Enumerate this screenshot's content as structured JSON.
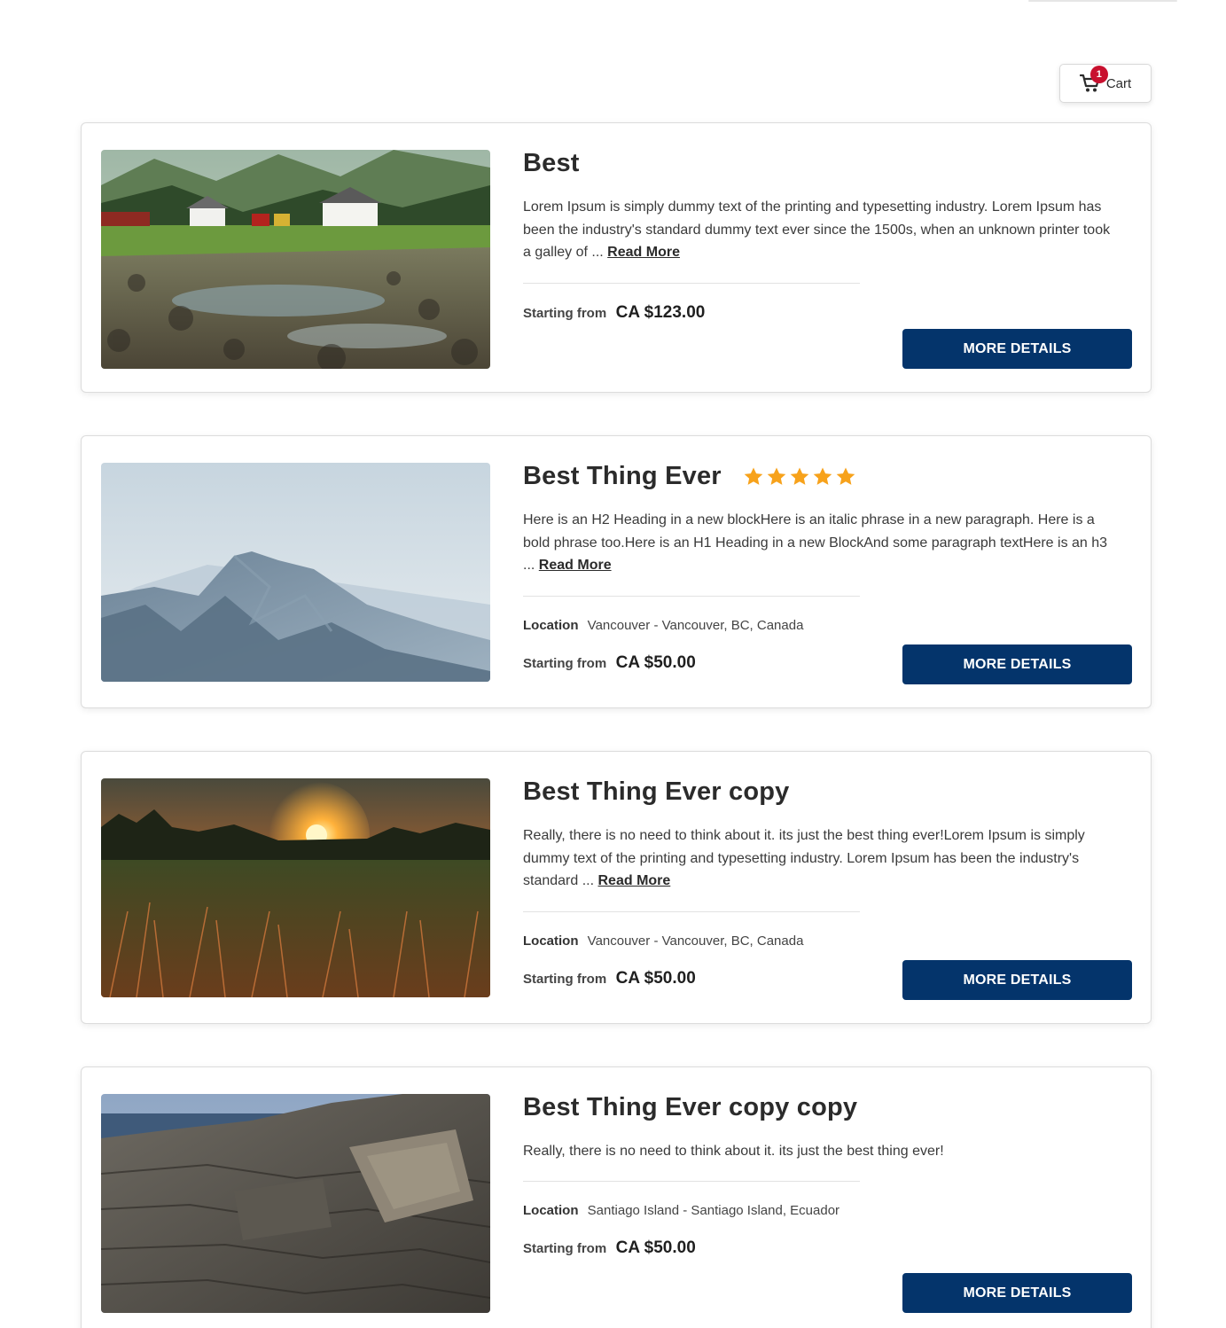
{
  "cart": {
    "label": "Cart",
    "count": "1"
  },
  "labels": {
    "starting_from": "Starting from",
    "location": "Location",
    "read_more": "Read More",
    "more_details": "MORE DETAILS"
  },
  "colors": {
    "primary": "#04346b",
    "badge": "#c8102e",
    "star": "#f7a21b"
  },
  "listings": [
    {
      "title": "Best",
      "description": "Lorem Ipsum is simply dummy text of the printing and typesetting industry. Lorem Ipsum has been the industry's standard dummy text ever since the 1500s, when an unknown printer took a galley of ...",
      "price": "CA $123.00",
      "image": "village-meadow"
    },
    {
      "title": "Best Thing Ever",
      "rating": 5,
      "description": "Here is an H2 Heading in a new blockHere is an italic phrase in a new paragraph. Here is a bold phrase too.Here is an H1 Heading in a new BlockAnd some paragraph textHere is an h3 ...",
      "location": "Vancouver -  Vancouver, BC, Canada",
      "price": "CA $50.00",
      "image": "misty-mountains"
    },
    {
      "title": "Best Thing Ever copy",
      "description": "Really, there is no need to think about it. its just the best thing ever!Lorem Ipsum is simply dummy text of the printing and typesetting industry. Lorem Ipsum has been the industry's standard ...",
      "location": "Vancouver -  Vancouver, BC, Canada",
      "price": "CA $50.00",
      "image": "sunset-field"
    },
    {
      "title": "Best Thing Ever copy copy",
      "description": "Really, there is no need to think about it. its just the best thing ever!",
      "location": "Santiago Island -  Santiago Island, Ecuador",
      "price": "CA $50.00",
      "image": "rocky-coast"
    }
  ]
}
